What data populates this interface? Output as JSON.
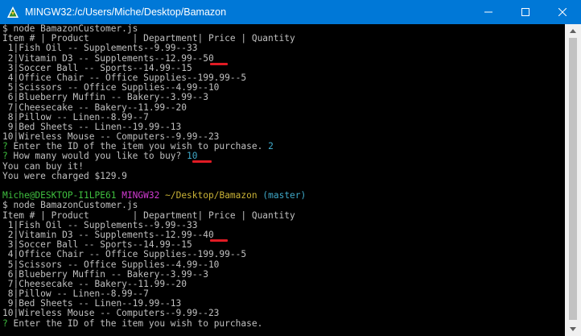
{
  "window": {
    "title": "MINGW32:/c/Users/Miche/Desktop/Bamazon",
    "icon": "mingw-terminal-icon",
    "controls": [
      "minimize-icon",
      "maximize-icon",
      "close-icon"
    ]
  },
  "colors": {
    "titlebar": "#0078d7",
    "terminal_bg": "#000000",
    "text": "#c0c0c0",
    "prompt_user": "#3fbf3f",
    "prompt_mingw": "#d33bd3",
    "prompt_path": "#c9b236",
    "prompt_branch": "#3fa9c9",
    "annotation_underline": "#e01b24"
  },
  "terminal": {
    "lines": [
      {
        "segs": [
          "$ node BamazonCustomer.js"
        ]
      },
      {
        "segs": [
          "Item # | Product        | Department| Price | Quantity"
        ]
      },
      {
        "segs": [
          " 1|Fish Oil -- Supplements--9.99--33"
        ]
      },
      {
        "segs": [
          " 2|Vitamin D3 -- Supplements--12.99--50"
        ]
      },
      {
        "segs": [
          " 3|Soccer Ball -- Sports--14.99--15"
        ]
      },
      {
        "segs": [
          " 4|Office Chair -- Office Supplies--199.99--5"
        ]
      },
      {
        "segs": [
          " 5|Scissors -- Office Supplies--4.99--10"
        ]
      },
      {
        "segs": [
          " 6|Blueberry Muffin -- Bakery--3.99--3"
        ]
      },
      {
        "segs": [
          " 7|Cheesecake -- Bakery--11.99--20"
        ]
      },
      {
        "segs": [
          " 8|Pillow -- Linen--8.99--7"
        ]
      },
      {
        "segs": [
          " 9|Bed Sheets -- Linen--19.99--13"
        ]
      },
      {
        "segs": [
          "10|Wireless Mouse -- Computers--9.99--23"
        ]
      },
      {
        "segs": [
          "? ",
          "Enter the ID of the item you wish to purchase. ",
          "2"
        ]
      },
      {
        "segs": [
          "? ",
          "How many would you like to buy? ",
          "10"
        ]
      },
      {
        "segs": [
          "You can buy it!"
        ]
      },
      {
        "segs": [
          "You were charged $129.9"
        ]
      },
      {
        "segs": [
          ""
        ]
      },
      {
        "segs": [
          "Miche@DESKTOP-I1LPE61",
          " ",
          "MINGW32",
          " ",
          "~/Desktop/Bamazon",
          " ",
          "(master)"
        ]
      },
      {
        "segs": [
          "$ node BamazonCustomer.js"
        ]
      },
      {
        "segs": [
          "Item # | Product        | Department| Price | Quantity"
        ]
      },
      {
        "segs": [
          " 1|Fish Oil -- Supplements--9.99--33"
        ]
      },
      {
        "segs": [
          " 2|Vitamin D3 -- Supplements--12.99--40"
        ]
      },
      {
        "segs": [
          " 3|Soccer Ball -- Sports--14.99--15"
        ]
      },
      {
        "segs": [
          " 4|Office Chair -- Office Supplies--199.99--5"
        ]
      },
      {
        "segs": [
          " 5|Scissors -- Office Supplies--4.99--10"
        ]
      },
      {
        "segs": [
          " 6|Blueberry Muffin -- Bakery--3.99--3"
        ]
      },
      {
        "segs": [
          " 7|Cheesecake -- Bakery--11.99--20"
        ]
      },
      {
        "segs": [
          " 8|Pillow -- Linen--8.99--7"
        ]
      },
      {
        "segs": [
          " 9|Bed Sheets -- Linen--19.99--13"
        ]
      },
      {
        "segs": [
          "10|Wireless Mouse -- Computers--9.99--23"
        ]
      },
      {
        "segs": [
          "? ",
          "Enter the ID of the item you wish to purchase."
        ]
      }
    ]
  }
}
